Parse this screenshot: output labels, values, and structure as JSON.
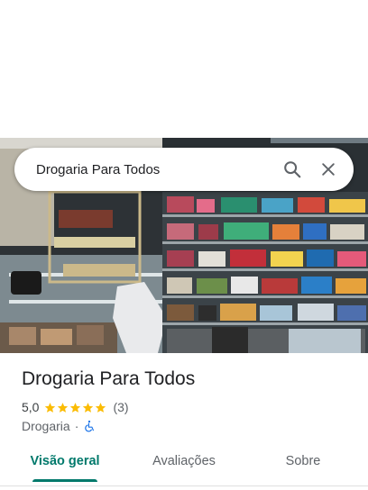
{
  "search": {
    "query": "Drogaria Para Todos"
  },
  "place": {
    "name": "Drogaria Para Todos",
    "rating": "5,0",
    "stars": 5,
    "review_count": "(3)",
    "category": "Drogaria",
    "separator": "·"
  },
  "tabs": [
    {
      "label": "Visão geral",
      "active": true
    },
    {
      "label": "Avaliações",
      "active": false
    },
    {
      "label": "Sobre",
      "active": false
    }
  ],
  "colors": {
    "accent": "#00796b",
    "star": "#fbbc04",
    "accessibility": "#1a73e8"
  },
  "icons": {
    "search": "search-icon",
    "close": "close-icon",
    "accessibility": "wheelchair-accessible-icon"
  }
}
